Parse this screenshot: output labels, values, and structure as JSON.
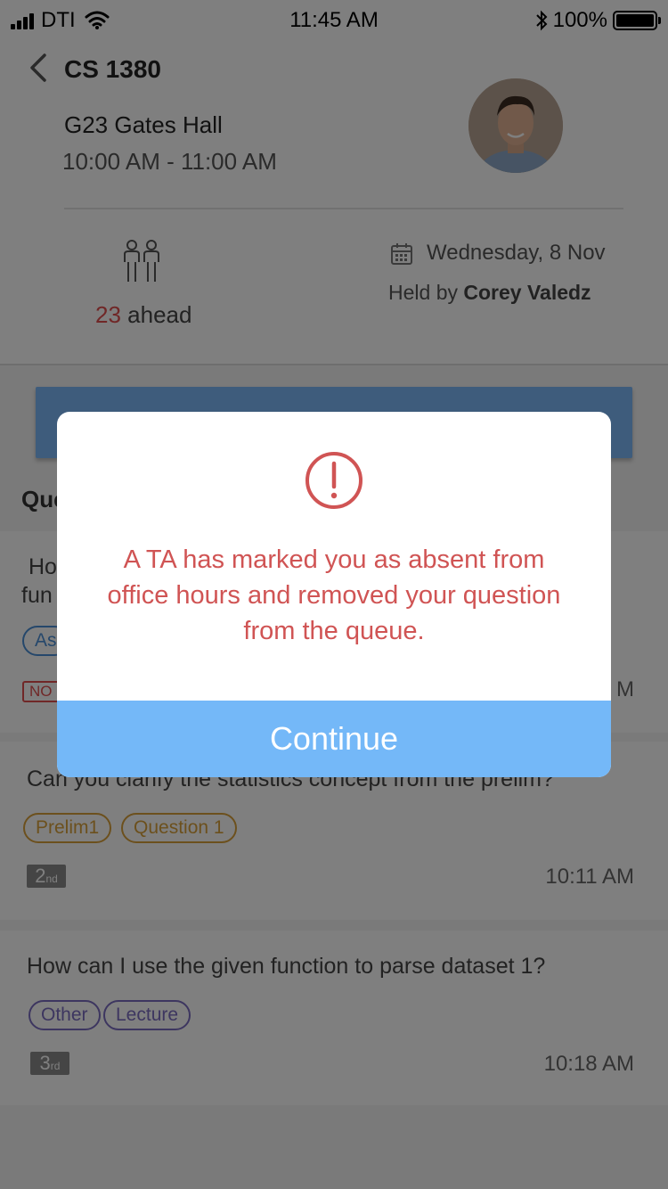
{
  "status_bar": {
    "carrier": "DTI",
    "time": "11:45 AM",
    "battery": "100%"
  },
  "header": {
    "course": "CS 1380",
    "location": "G23 Gates Hall",
    "time_range": "10:00 AM - 11:00 AM"
  },
  "info": {
    "ahead_count": "23",
    "ahead_label": "ahead",
    "date": "Wednesday, 8 Nov",
    "held_by_prefix": "Held by ",
    "ta_name": "Corey Valedz"
  },
  "queue": {
    "heading": "Que",
    "items": [
      {
        "question_line1": "Ho",
        "question_line2": "fun",
        "tag": "As",
        "status": "NO",
        "time": "M"
      },
      {
        "question": "Can you clarify the statistics concept from the prelim?",
        "tags": [
          "Prelim1",
          "Question 1"
        ],
        "rank_num": "2",
        "rank_suffix": "nd",
        "time": "10:11 AM"
      },
      {
        "question": "How can I use the given function to parse dataset 1?",
        "tags": [
          "Other",
          "Lecture"
        ],
        "rank_num": "3",
        "rank_suffix": "rd",
        "time": "10:18 AM"
      }
    ]
  },
  "modal": {
    "icon": "alert-circle-icon",
    "message": "A TA has marked you as absent from office hours and removed your question from the queue.",
    "button_label": "Continue"
  },
  "colors": {
    "accent_blue": "#74b8f8",
    "alert_red": "#d05454",
    "count_red": "#e04e4e"
  }
}
